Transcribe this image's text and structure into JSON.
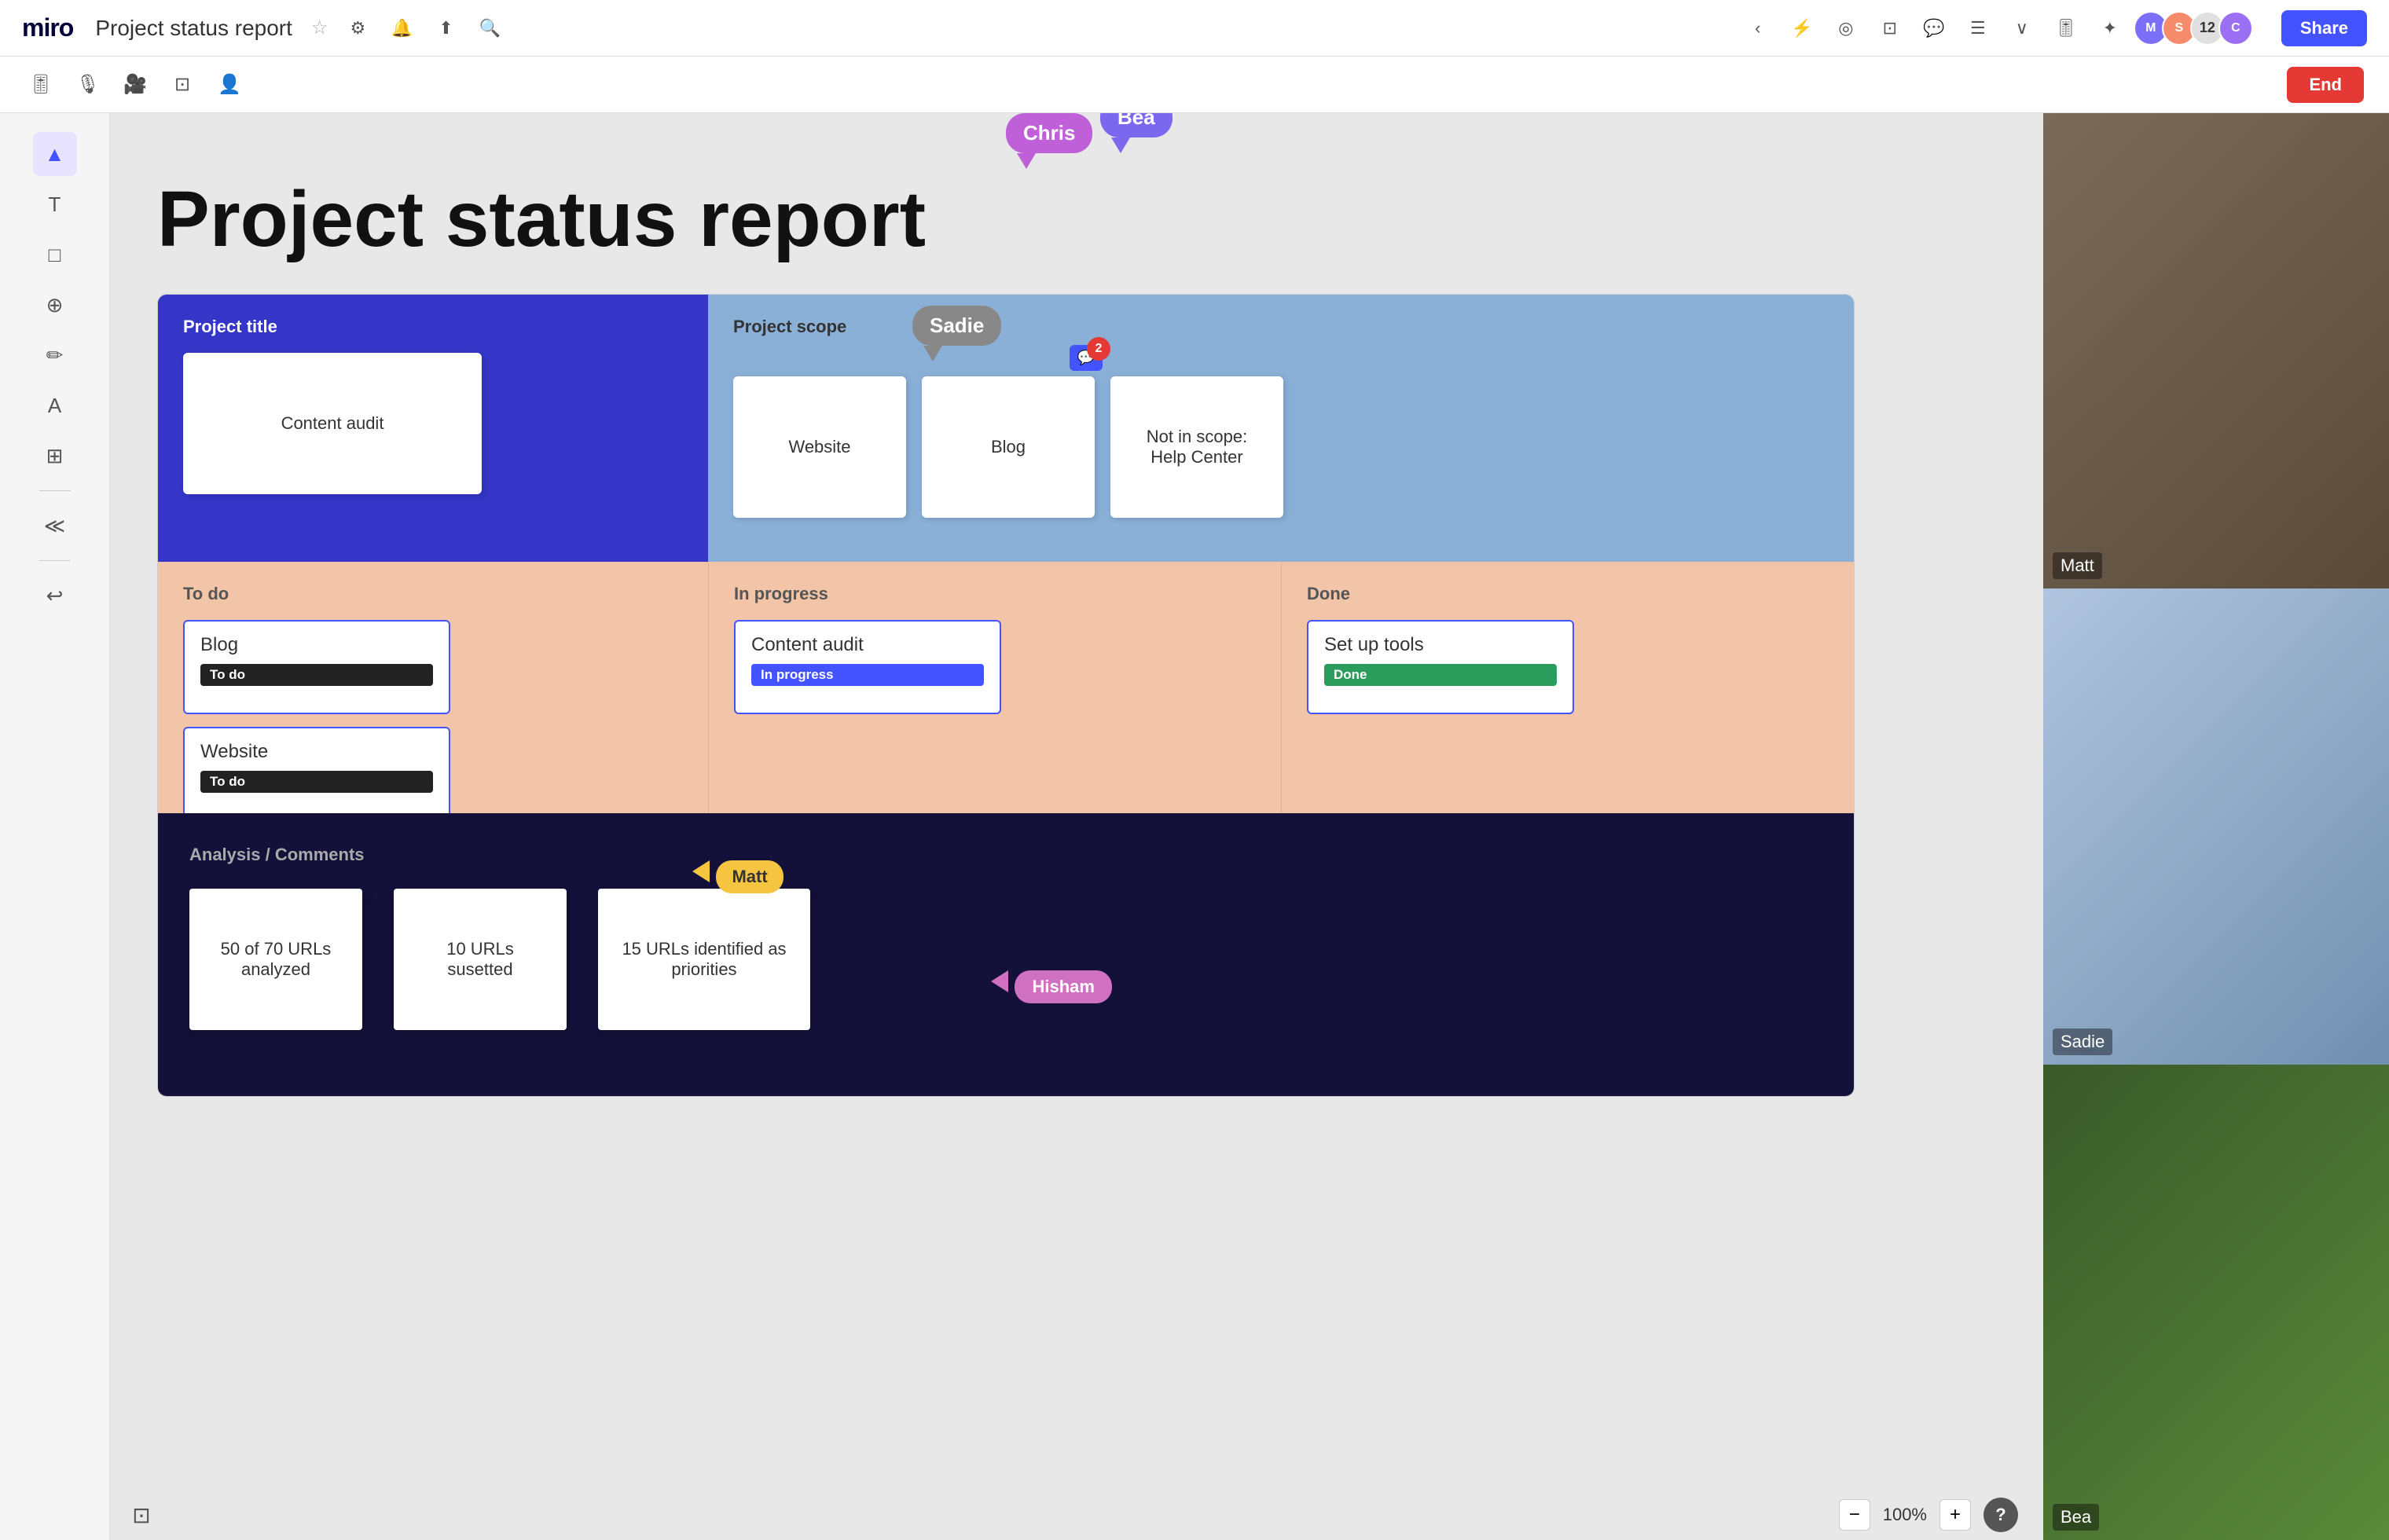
{
  "app": {
    "logo": "miro",
    "board_title": "Project status report",
    "share_label": "Share",
    "end_label": "End"
  },
  "topbar": {
    "icons": [
      "⚙",
      "🔔",
      "⬆",
      "🔍"
    ],
    "zoom_icons": [
      "⚡",
      "◎",
      "⊡",
      "💬",
      "☰",
      "∨"
    ]
  },
  "toolbar2": {
    "icons": [
      "🎚",
      "🎙",
      "🎥",
      "⊡",
      "👤"
    ],
    "end_label": "End"
  },
  "left_toolbar": {
    "tools": [
      "▲",
      "T",
      "□",
      "⊕",
      "✏",
      "A",
      "⊞",
      "≪",
      "↩"
    ]
  },
  "board": {
    "title": "Project status report",
    "sections": {
      "project_title": "Project title",
      "project_scope": "Project scope",
      "to_do": "To do",
      "in_progress": "In progress",
      "done": "Done",
      "analysis_comments": "Analysis / Comments"
    },
    "cards": {
      "content_audit": "Content audit",
      "website": "Website",
      "blog_scope": "Blog",
      "not_in_scope": "Not in scope:\nHelp Center",
      "blog_task": "Blog",
      "website_task": "Website",
      "content_audit_task": "Content audit",
      "set_up_tools": "Set up tools"
    },
    "badges": {
      "todo": "To do",
      "in_progress": "In progress",
      "done": "Done"
    },
    "sticky_notes": {
      "s1": "50 of 70 URLs analyzed",
      "s2": "10 URLs susetted",
      "s3": "15 URLs identified as priorities"
    }
  },
  "cursors": {
    "chris": "Chris",
    "bea": "Bea",
    "sadie": "Sadie",
    "matt": "Matt",
    "hisham": "Hisham"
  },
  "video": {
    "participants": [
      {
        "name": "Matt"
      },
      {
        "name": "Sadie"
      },
      {
        "name": "Bea"
      }
    ]
  },
  "zoom": {
    "level": "100%",
    "minus": "−",
    "plus": "+"
  }
}
